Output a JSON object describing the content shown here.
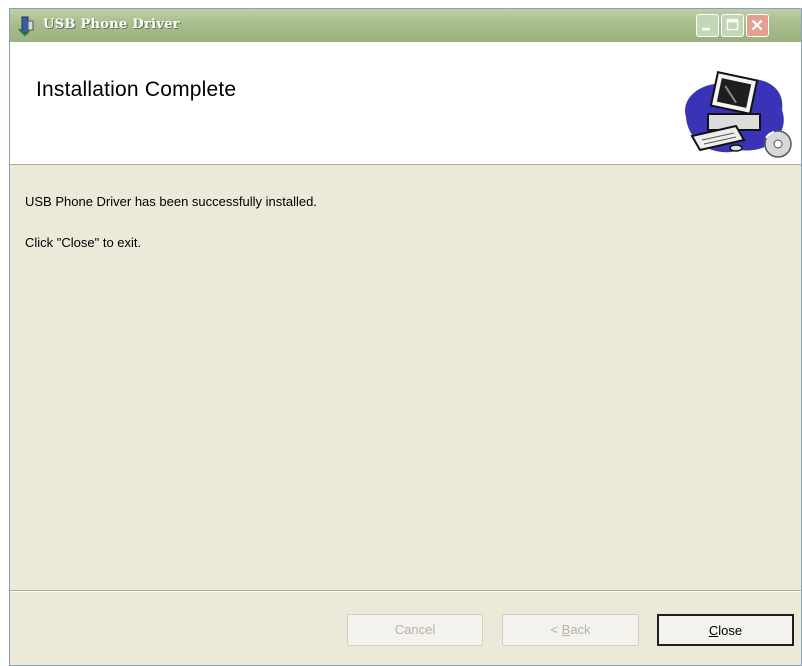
{
  "window": {
    "title": "USB Phone Driver",
    "icon": "installer-icon"
  },
  "header": {
    "title": "Installation Complete",
    "graphic": "computer-cd-icon"
  },
  "content": {
    "message1": "USB Phone Driver has been successfully installed.",
    "message2": "Click \"Close\" to exit."
  },
  "buttons": {
    "cancel": {
      "label": "Cancel",
      "enabled": false
    },
    "back": {
      "prefix": "< ",
      "mnemonic": "B",
      "rest": "ack",
      "enabled": false
    },
    "close": {
      "mnemonic": "C",
      "rest": "lose",
      "enabled": true,
      "default": true
    }
  },
  "colors": {
    "titlebar": "#a9bd8d",
    "dialog_bg": "#ece9d8",
    "header_bg": "#ffffff"
  }
}
